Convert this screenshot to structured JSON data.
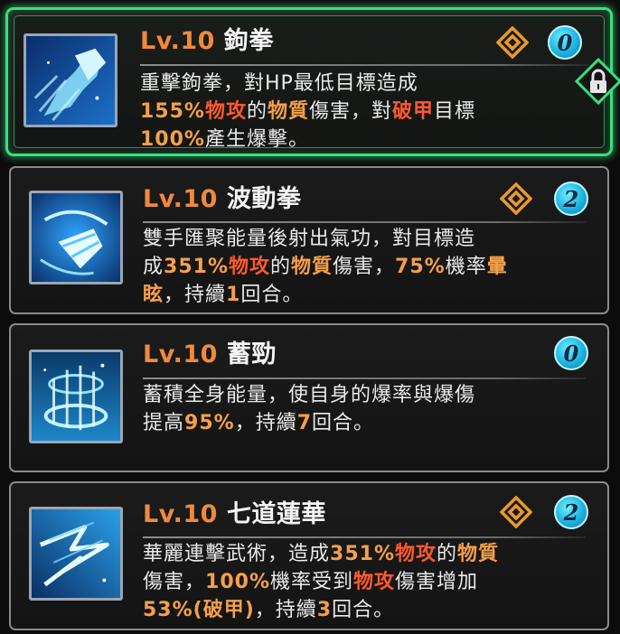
{
  "skills": [
    {
      "level": "Lv.10",
      "name": "鉤拳",
      "badge": "0",
      "selected": true,
      "icon": "punch-skill-icon",
      "lines": [
        [
          {
            "t": "重擊鉤拳，對HP最低目標造成",
            "c": ""
          }
        ],
        [
          {
            "t": "155%",
            "c": "o"
          },
          {
            "t": "物攻",
            "c": "r"
          },
          {
            "t": "的",
            "c": ""
          },
          {
            "t": "物質",
            "c": "o"
          },
          {
            "t": "傷害，對",
            "c": ""
          },
          {
            "t": "破甲",
            "c": "r"
          },
          {
            "t": "目標",
            "c": ""
          }
        ],
        [
          {
            "t": "100%",
            "c": "o"
          },
          {
            "t": "產生爆擊。",
            "c": ""
          }
        ]
      ]
    },
    {
      "level": "Lv.10",
      "name": "波動拳",
      "badge": "2",
      "selected": false,
      "icon": "wave-fist-skill-icon",
      "lines": [
        [
          {
            "t": "雙手匯聚能量後射出氣功，對目標造",
            "c": ""
          }
        ],
        [
          {
            "t": "成",
            "c": ""
          },
          {
            "t": "351%",
            "c": "o"
          },
          {
            "t": "物攻",
            "c": "r"
          },
          {
            "t": "的",
            "c": ""
          },
          {
            "t": "物質",
            "c": "o"
          },
          {
            "t": "傷害，",
            "c": ""
          },
          {
            "t": "75%",
            "c": "o"
          },
          {
            "t": "機率",
            "c": ""
          },
          {
            "t": "暈",
            "c": "o"
          }
        ],
        [
          {
            "t": "眩",
            "c": "o"
          },
          {
            "t": "，持續",
            "c": ""
          },
          {
            "t": "1",
            "c": "o"
          },
          {
            "t": "回合。",
            "c": ""
          }
        ]
      ]
    },
    {
      "level": "Lv.10",
      "name": "蓄勁",
      "badge": "0",
      "selected": false,
      "icon": "charge-up-skill-icon",
      "lines": [
        [
          {
            "t": "蓄積全身能量，使自身的爆率與爆傷",
            "c": ""
          }
        ],
        [
          {
            "t": "提高",
            "c": ""
          },
          {
            "t": "95%",
            "c": "o"
          },
          {
            "t": "，持續",
            "c": ""
          },
          {
            "t": "7",
            "c": "o"
          },
          {
            "t": "回合。",
            "c": ""
          }
        ]
      ]
    },
    {
      "level": "Lv.10",
      "name": "七道蓮華",
      "badge": "2",
      "selected": false,
      "icon": "seven-lotus-skill-icon",
      "lines": [
        [
          {
            "t": "華麗連擊武術，造成",
            "c": ""
          },
          {
            "t": "351%",
            "c": "o"
          },
          {
            "t": "物攻",
            "c": "r"
          },
          {
            "t": "的",
            "c": ""
          },
          {
            "t": "物質",
            "c": "o"
          }
        ],
        [
          {
            "t": "傷害，",
            "c": ""
          },
          {
            "t": "100%",
            "c": "o"
          },
          {
            "t": "機率受到",
            "c": ""
          },
          {
            "t": "物攻",
            "c": "r"
          },
          {
            "t": "傷害增加",
            "c": ""
          }
        ],
        [
          {
            "t": "53%(破甲)",
            "c": "o"
          },
          {
            "t": "，持續",
            "c": ""
          },
          {
            "t": "3",
            "c": "o"
          },
          {
            "t": "回合。",
            "c": ""
          }
        ]
      ]
    }
  ],
  "colors": {
    "level": "#f08a3a",
    "highlight_orange": "#f5a04a",
    "highlight_red": "#ff5a2e",
    "selected_border": "#36e27c",
    "badge": "#1fb3e0"
  },
  "lock_icon": "padlock-icon",
  "rank_icon": "diamond-rank-icon"
}
